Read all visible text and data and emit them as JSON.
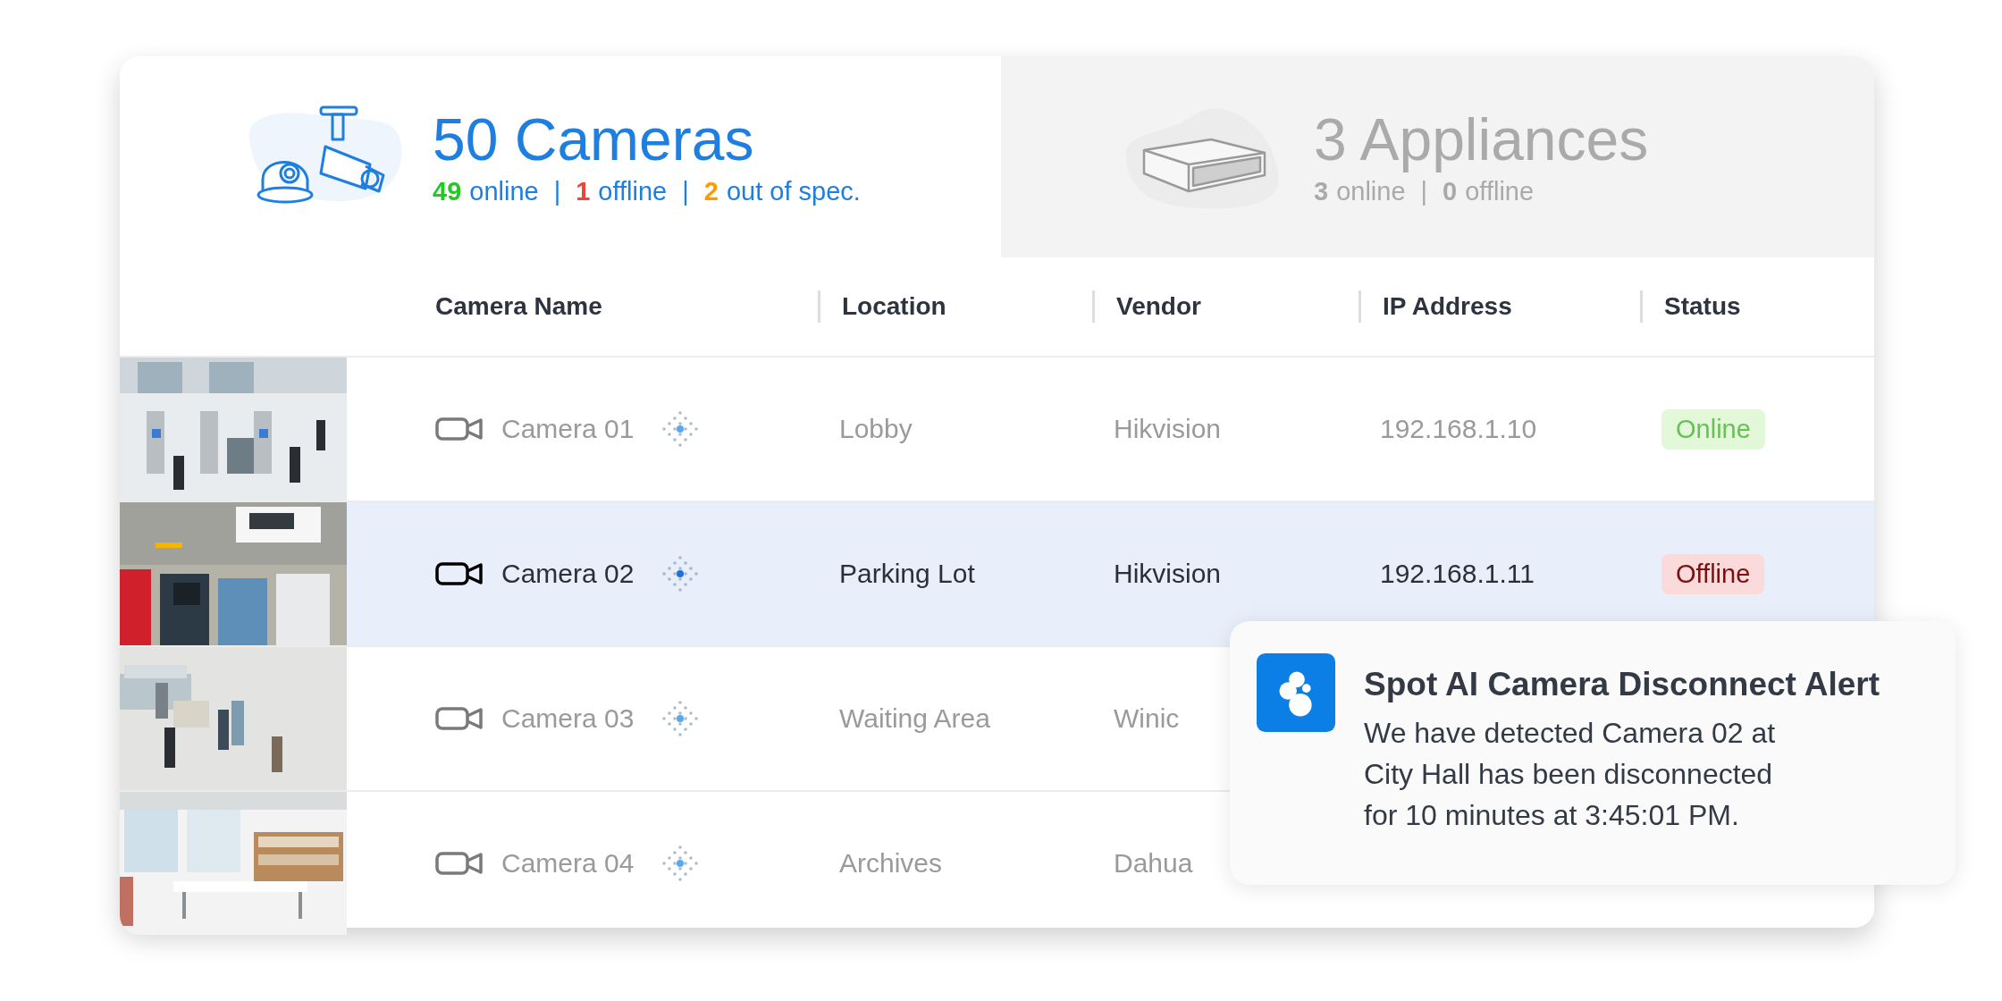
{
  "summary_tabs": [
    {
      "kind": "cameras",
      "selected": true,
      "title": "50 Cameras",
      "divider": "|",
      "stats": [
        {
          "count": "49",
          "label": "online",
          "color": "#22c922"
        },
        {
          "count": "1",
          "label": "offline",
          "color": "#f04438"
        },
        {
          "count": "2",
          "label": "out of spec.",
          "color": "#ff9a00"
        }
      ]
    },
    {
      "kind": "appliances",
      "selected": false,
      "title": "3 Appliances",
      "divider": "|",
      "stats": [
        {
          "count": "3",
          "label": "online",
          "color": "#a9a9a9"
        },
        {
          "count": "0",
          "label": "offline",
          "color": "#a9a9a9"
        }
      ]
    }
  ],
  "table": {
    "columns": [
      "Camera Name",
      "Location",
      "Vendor",
      "IP Address",
      "Status"
    ],
    "rows": [
      {
        "selected": false,
        "name": "Camera 01",
        "location": "Lobby",
        "vendor": "Hikvision",
        "ip": "192.168.1.10",
        "status": "Online",
        "online": true
      },
      {
        "selected": true,
        "name": "Camera 02",
        "location": "Parking Lot",
        "vendor": "Hikvision",
        "ip": "192.168.1.11",
        "status": "Offline",
        "online": false
      },
      {
        "selected": false,
        "name": "Camera 03",
        "location": "Waiting Area",
        "vendor": "Winic"
      },
      {
        "selected": false,
        "name": "Camera 04",
        "location": "Archives",
        "vendor": "Dahua"
      }
    ]
  },
  "alert": {
    "title": "Spot AI Camera Disconnect Alert",
    "message_lines": [
      "We have detected Camera 02 at",
      "City Hall has been disconnected",
      "for 10 minutes at 3:45:01 PM."
    ]
  }
}
